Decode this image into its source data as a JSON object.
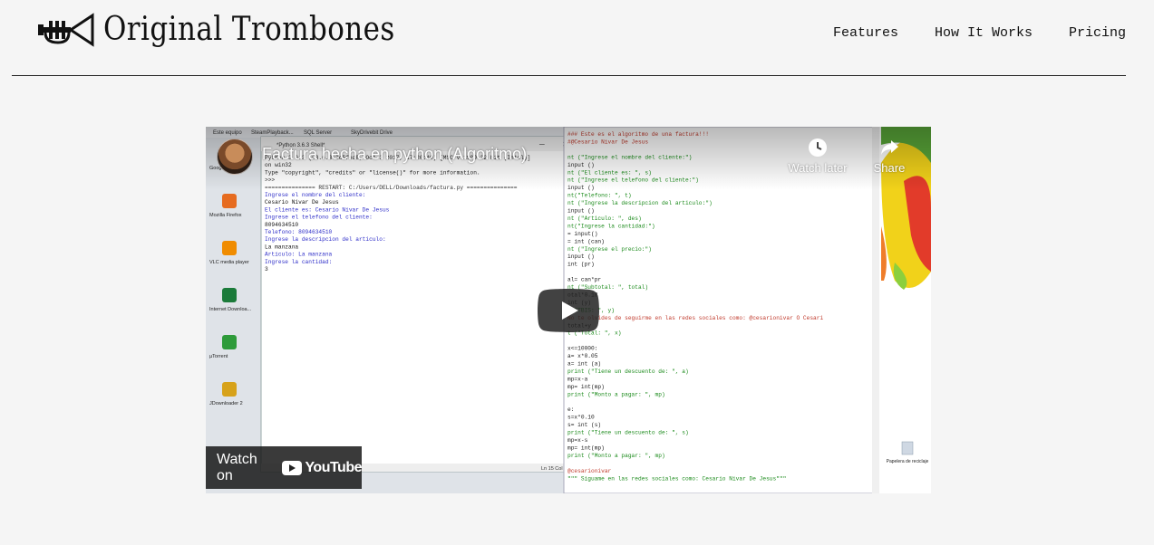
{
  "brand": {
    "name": "Original Trombones",
    "icon": "trumpet-icon"
  },
  "nav": {
    "items": [
      "Features",
      "How It Works",
      "Pricing"
    ]
  },
  "video": {
    "title": "Factura hecha en python (Algoritmo)",
    "watch_later": "Watch later",
    "share": "Share",
    "watch_on": "Watch on",
    "youtube": "YouTube",
    "icons": {
      "play": "play-icon",
      "clock": "clock-icon",
      "share": "share-icon"
    },
    "screen": {
      "desktop_icons": [
        "Google Chrome",
        "Mozilla Firefox",
        "VLC media player",
        "Internet Downloa...",
        "µTorrent",
        "JDownloader 2"
      ],
      "recycle_bin": "Papelera de reciclaje",
      "taskbar_items": [
        "Este equipo",
        "SteamPlayback...",
        "SQL Server",
        "SkyDrivebit Drive"
      ],
      "shell_title": "*Python 3.6.3 Shell*",
      "shell_lines": [
        "Python 3.6.3 (v3.6.3:2c5fed8, Oct  3 2017, 17:26:49) [MSC v.1900 32 bit (Intel)]",
        " on win32",
        "Type \"copyright\", \"credits\" or \"license()\" for more information.",
        ">>>",
        "=============== RESTART: C:/Users/DELL/Downloads/factura.py ===============",
        "Ingrese el nombre del cliente:",
        "Cesario Nivar De Jesus",
        "El cliente es:  Cesario Nivar De Jesus",
        "Ingrese el telefono del cliente:",
        "8094634510",
        "Telefono:  8094634510",
        "Ingrese la descripcion del articulo:",
        "La manzana",
        "Articulo:  La manzana",
        "Ingrese la cantidad:",
        "3"
      ],
      "shell_status": "Ln 15  Col 0",
      "editor_lines": [
        "### Este es el algoritmo de una factura!!!",
        "#@Cesario Nivar De Jesus",
        "",
        "nt (\"Ingrese el nombre del cliente:\")",
        " input ()",
        "nt (\"El cliente es: \", s)",
        "nt (\"Ingrese el telefono del cliente:\")",
        " input ()",
        "nt(\"Telefono: \", t)",
        "nt (\"Ingrese la descripcion del articulo:\")",
        " input ()",
        "nt (\"Articulo: \", des)",
        "nt(\"Ingrese la cantidad:\")",
        "= input()",
        "= int (can)",
        "nt (\"Ingrese el precio:\")",
        " input ()",
        " int (pr)",
        "",
        "al= can*pr",
        "nt (\"Subtotal: \", total)",
        "otal*0.18",
        "int (y)",
        " (\"ITBIS: \", y)",
        "No te olvides de seguirme en las redes sociales como: @cesarionivar O Cesari",
        "total+y",
        "t (\"Total: \", x)",
        "",
        "x<=10000:",
        " a= x*0.05",
        " a= int (a)",
        " print (\"Tiene un descuento de: \", a)",
        " mp=x-a",
        " mp= int(mp)",
        " print (\"Monto a pagar: \", mp)",
        "",
        "e:",
        " s=x*0.10",
        " s= int (s)",
        " print (\"Tiene un descuento de: \", s)",
        " mp=x-s",
        " mp= int(mp)",
        " print (\"Monto a pagar: \", mp)",
        "",
        "@cesarionivar",
        " \"\"\" Siguame en las redes sociales como: Cesario Nivar De Jesus\"\"\""
      ]
    }
  }
}
